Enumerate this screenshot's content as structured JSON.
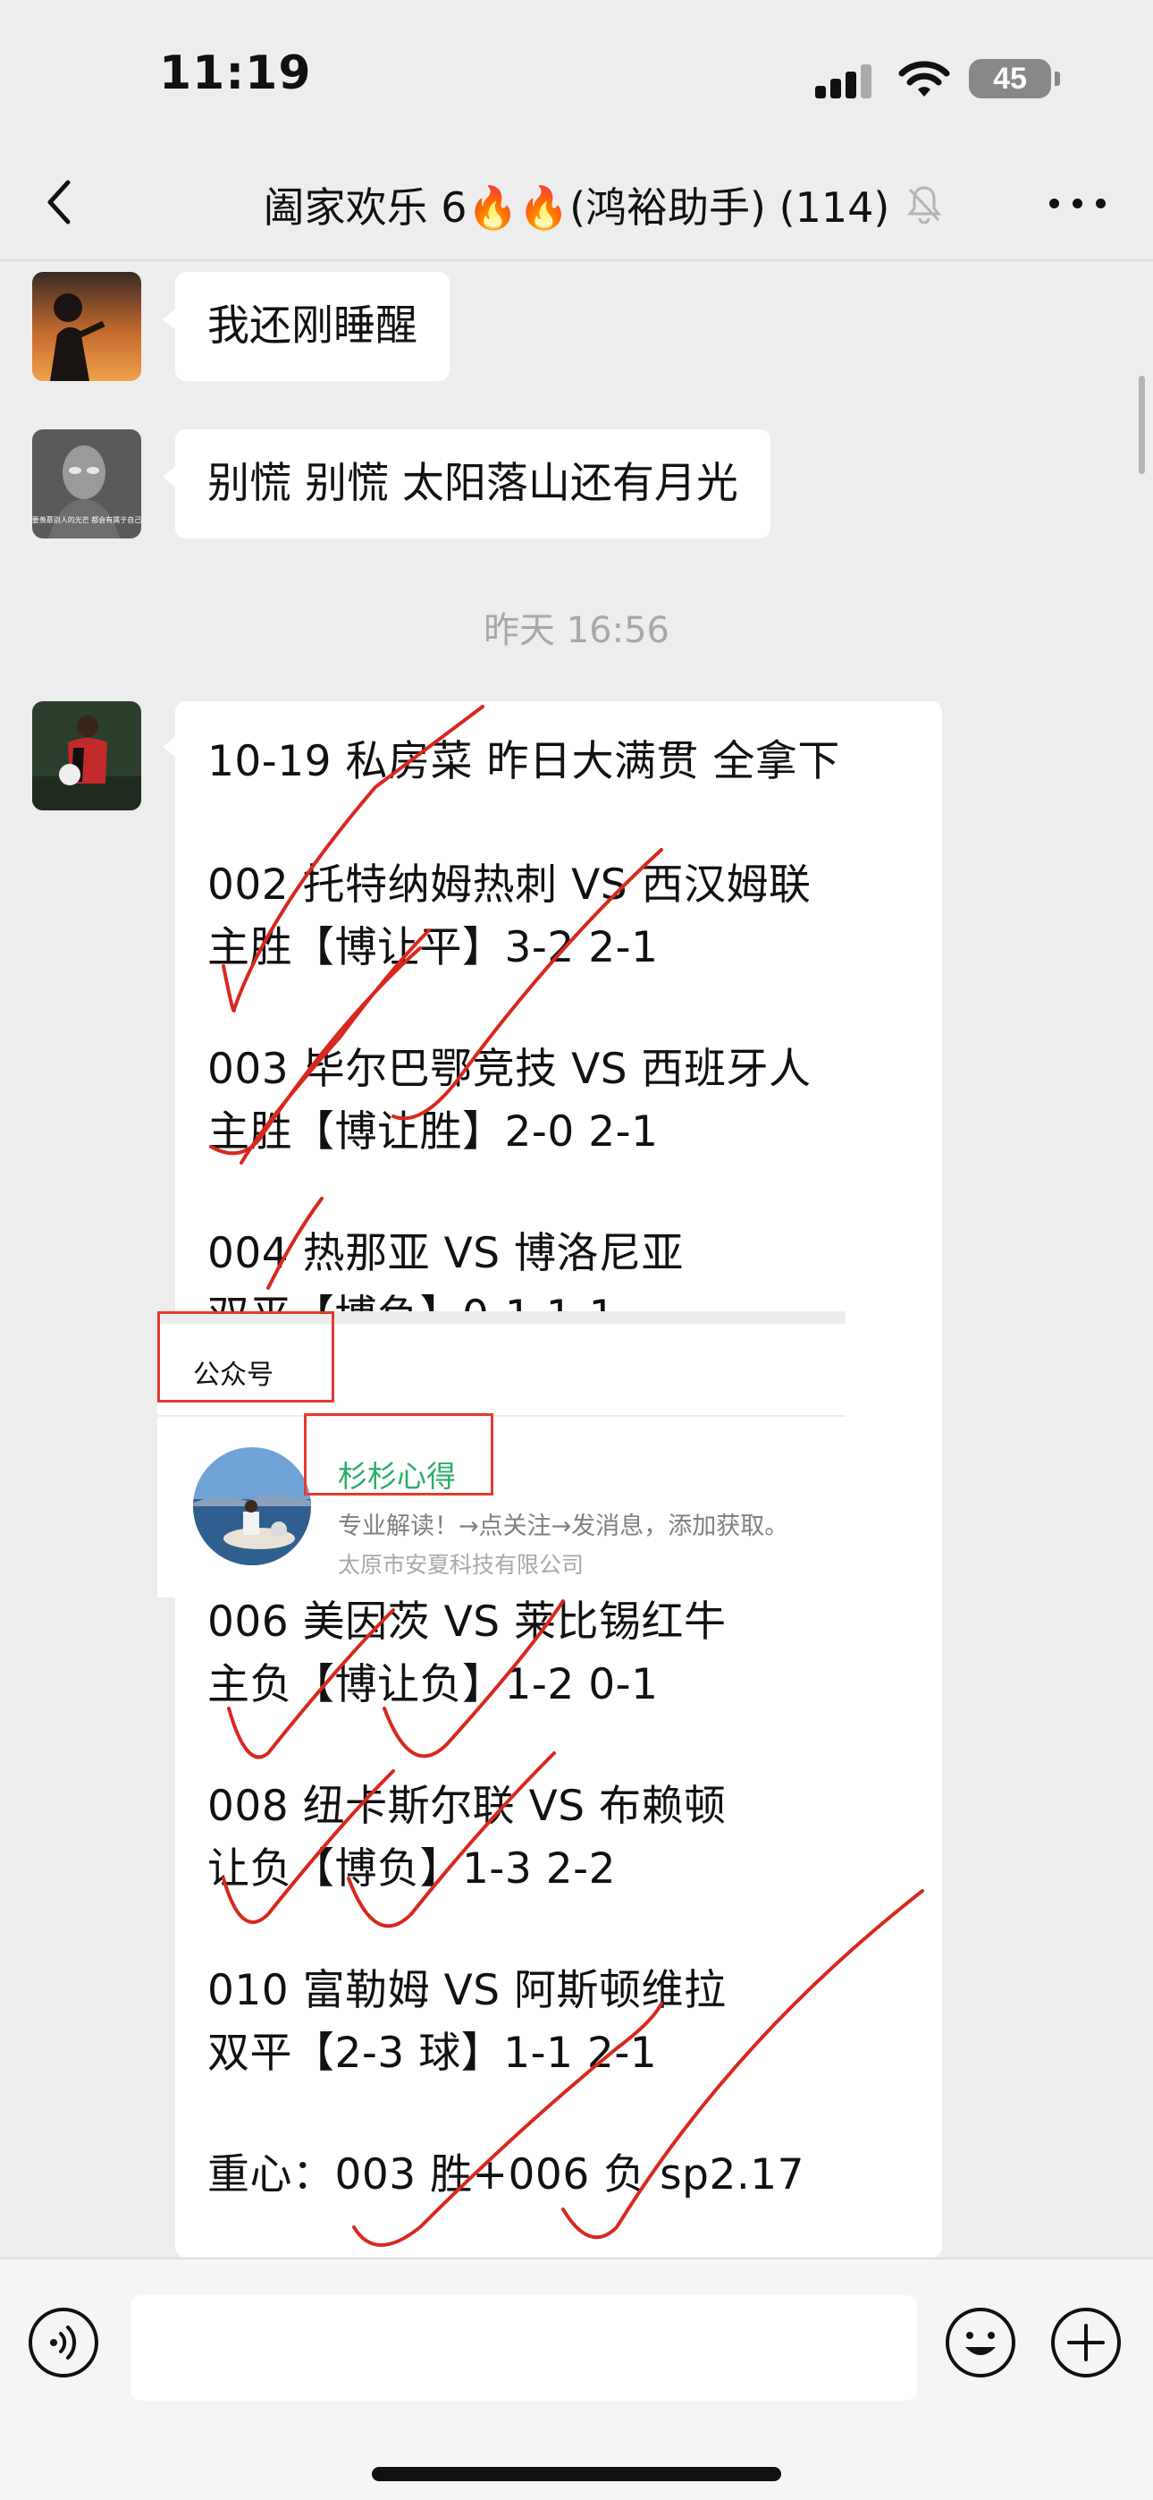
{
  "status": {
    "time": "11:19",
    "battery": "45"
  },
  "header": {
    "back_icon": "chevron-left-icon",
    "title": "阖家欢乐 6🔥🔥(鸿裕助手) (114)",
    "mute_icon": "bell-slash-icon",
    "more_icon": "ellipsis-icon"
  },
  "messages": [
    {
      "text": "我还刚睡醒"
    },
    {
      "text": "别慌 别慌 太阳落山还有月光",
      "avatar_caption": "不要羡慕别人的光芒 都会有属于自己的"
    },
    {
      "timestamp": "昨天 16:56"
    }
  ],
  "post": {
    "lines": [
      "10-19 私房菜 昨日大满贯 全拿下",
      "002 托特纳姆热刺 VS 西汉姆联",
      "主胜【博让平】3-2 2-1",
      "003 毕尔巴鄂竞技 VS 西班牙人",
      "主胜【博让胜】2-0 2-1",
      "004 热那亚 VS 博洛尼亚",
      "双平【博负】0-1 1-1",
      "006 美因茨 VS 莱比锡红牛",
      "主负【博让负】1-2 0-1",
      "008 纽卡斯尔联 VS 布赖顿",
      "让负【博负】1-3 2-2",
      "010 富勒姆 VS 阿斯顿维拉",
      "双平【2-3 球】1-1 2-1",
      "重心：003 胜+006 负 sp2.17"
    ]
  },
  "oa_card": {
    "label": "公众号",
    "name": "杉杉心得",
    "description": "专业解读！→点关注→发消息，添加获取。",
    "company": "太原市安夏科技有限公司"
  },
  "input_bar": {
    "voice_icon": "voice-icon",
    "emoji_icon": "emoji-icon",
    "plus_icon": "plus-icon"
  },
  "colors": {
    "background": "#ededed",
    "bubble": "#ffffff",
    "ink": "#d8281e",
    "oa_name": "#2aae67",
    "highlight_box": "#e23b30"
  }
}
